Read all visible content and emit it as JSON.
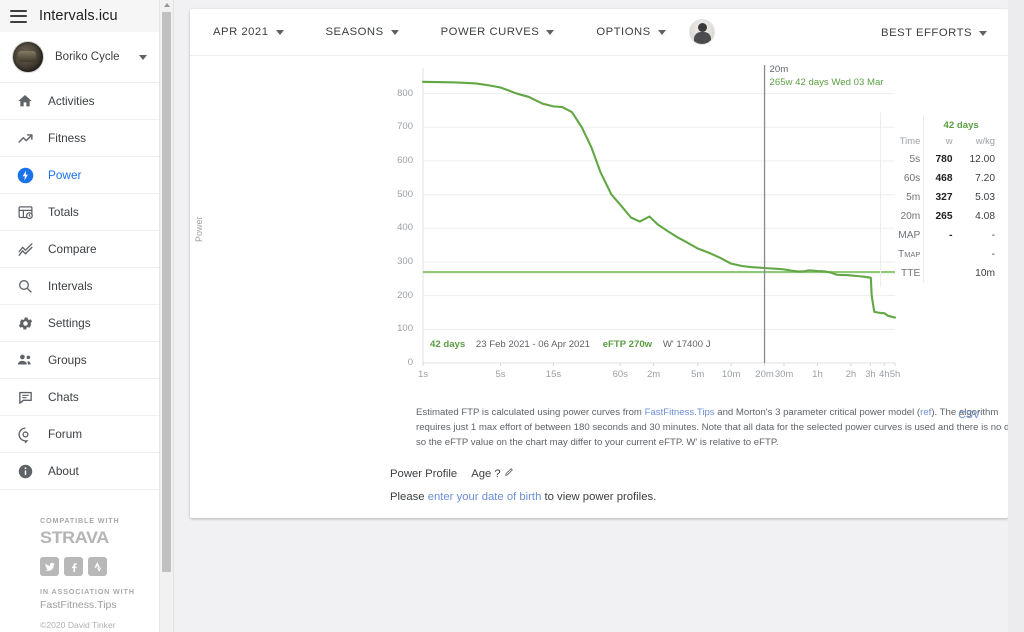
{
  "app": {
    "brand": "Intervals.icu",
    "menu_icon": "hamburger-icon"
  },
  "sidebar": {
    "profile": {
      "name": "Boriko Cycle",
      "caret": "chevron-down-icon"
    },
    "items": [
      {
        "label": "Activities",
        "icon": "home-icon",
        "active": false
      },
      {
        "label": "Fitness",
        "icon": "trending-up-icon",
        "active": false
      },
      {
        "label": "Power",
        "icon": "power-bolt-icon",
        "active": true
      },
      {
        "label": "Totals",
        "icon": "table-clock-icon",
        "active": false
      },
      {
        "label": "Compare",
        "icon": "compare-lines-icon",
        "active": false
      },
      {
        "label": "Intervals",
        "icon": "search-icon",
        "active": false
      },
      {
        "label": "Settings",
        "icon": "gear-icon",
        "active": false
      },
      {
        "label": "Groups",
        "icon": "people-icon",
        "active": false
      },
      {
        "label": "Chats",
        "icon": "chat-icon",
        "active": false
      },
      {
        "label": "Forum",
        "icon": "forum-icon",
        "active": false
      },
      {
        "label": "About",
        "icon": "info-icon",
        "active": false
      }
    ],
    "footer": {
      "compatible_with": "COMPATIBLE WITH",
      "strava": "STRAVA",
      "socials": [
        "twitter-icon",
        "facebook-icon",
        "strava-icon"
      ],
      "in_association_with": "IN ASSOCIATION WITH",
      "partner": "FastFitness.Tips",
      "copyright": "©2020 David Tinker"
    }
  },
  "toolbar": {
    "buttons": [
      {
        "label": "APR 2021",
        "caret": "chevron-down-icon"
      },
      {
        "label": "SEASONS",
        "caret": "chevron-down-icon"
      },
      {
        "label": "POWER CURVES",
        "caret": "chevron-down-icon"
      },
      {
        "label": "OPTIONS",
        "caret": "chevron-down-icon"
      }
    ],
    "avatar": "user-avatar",
    "best_efforts": {
      "label": "BEST EFFORTS",
      "caret": "chevron-down-icon"
    }
  },
  "best_efforts_table": {
    "period_header": "42 days",
    "columns": [
      "Time",
      "w",
      "w/kg"
    ],
    "rows": [
      {
        "time": "5s",
        "w": "780",
        "wkg": "12.00"
      },
      {
        "time": "60s",
        "w": "468",
        "wkg": "7.20"
      },
      {
        "time": "5m",
        "w": "327",
        "wkg": "5.03"
      },
      {
        "time": "20m",
        "w": "265",
        "wkg": "4.08"
      },
      {
        "time": "MAP",
        "w": "-",
        "wkg": "-"
      },
      {
        "time": "TMAP",
        "w": "",
        "wkg": "-"
      },
      {
        "time": "TTE",
        "w": "",
        "wkg": "10m"
      }
    ]
  },
  "chart_data": {
    "type": "line",
    "title": "",
    "xlabel": "",
    "ylabel": "Power",
    "ylim": [
      0,
      870
    ],
    "yticks": [
      0,
      100,
      200,
      300,
      400,
      500,
      600,
      700,
      800
    ],
    "xtick_labels": [
      "1s",
      "5s",
      "15s",
      "60s",
      "2m",
      "5m",
      "10m",
      "20m",
      "30m",
      "1h",
      "2h",
      "3h",
      "4h",
      "5h"
    ],
    "xtick_seconds": [
      1,
      5,
      15,
      60,
      120,
      300,
      600,
      1200,
      1800,
      3600,
      7200,
      10800,
      14400,
      18000
    ],
    "grid": "horizontal",
    "legend_position": "none",
    "line_color": "#62a744",
    "series": [
      {
        "name": "42 days power curve",
        "x_seconds": [
          1,
          2,
          3,
          4,
          5,
          7,
          9,
          12,
          15,
          18,
          22,
          27,
          33,
          40,
          50,
          60,
          75,
          90,
          110,
          130,
          160,
          200,
          240,
          300,
          380,
          480,
          600,
          750,
          900,
          1100,
          1320,
          1500,
          1800,
          2100,
          2400,
          2700,
          3000,
          3300,
          3600,
          4200,
          4800,
          5400,
          6000,
          6600,
          7200,
          8400,
          9600,
          10500,
          10900,
          11100,
          11700,
          12600,
          13800,
          14400,
          15600,
          16200,
          17400,
          18000
        ],
        "y_watts": [
          835,
          833,
          830,
          824,
          818,
          800,
          790,
          770,
          762,
          760,
          745,
          700,
          640,
          565,
          500,
          470,
          432,
          420,
          435,
          412,
          392,
          372,
          358,
          340,
          327,
          312,
          295,
          288,
          285,
          283,
          281,
          280,
          278,
          274,
          272,
          272,
          275,
          274,
          273,
          272,
          268,
          262,
          261,
          261,
          260,
          258,
          256,
          254,
          253,
          200,
          152,
          150,
          148,
          148,
          140,
          139,
          136,
          135
        ]
      },
      {
        "name": "eFTP line",
        "constant": 270,
        "color": "#8ec878"
      }
    ],
    "cursor": {
      "x_label": "20m",
      "line1": "20m",
      "line2": "265w  42 days  Wed 03 Mar",
      "x_seconds": 1200,
      "value_w": 265
    },
    "inchart_legend": {
      "days": "42 days",
      "range": "23 Feb 2021 - 06 Apr 2021",
      "eftp": "eFTP 270w",
      "wprime": "W' 17400 J"
    }
  },
  "notes": {
    "p1_a": "Estimated FTP is calculated using power curves from ",
    "link1": "FastFitness.Tips",
    "p1_b": " and Morton's 3 parameter critical power model (",
    "link2": "ref",
    "p1_c": "). The algorithm requires just 1 max effort of between 180 seconds and 30 minutes. Note that all data for the selected power curves is used and there is no decay so the eFTP value on the chart may differ to your current eFTP. W' is relative to eFTP.",
    "csv": "CSV"
  },
  "power_profile": {
    "title": "Power Profile",
    "age_label": "Age ?",
    "edit_icon": "pencil-icon",
    "note_a": "Please ",
    "note_link": "enter your date of birth",
    "note_b": " to view power profiles."
  },
  "colors": {
    "accent_blue": "#1a73e8",
    "link_blue": "#6b8fd4",
    "green_line": "#62a744",
    "eftp_green": "#8ec878",
    "text": "#3c4043",
    "muted": "#9aa0a6"
  }
}
